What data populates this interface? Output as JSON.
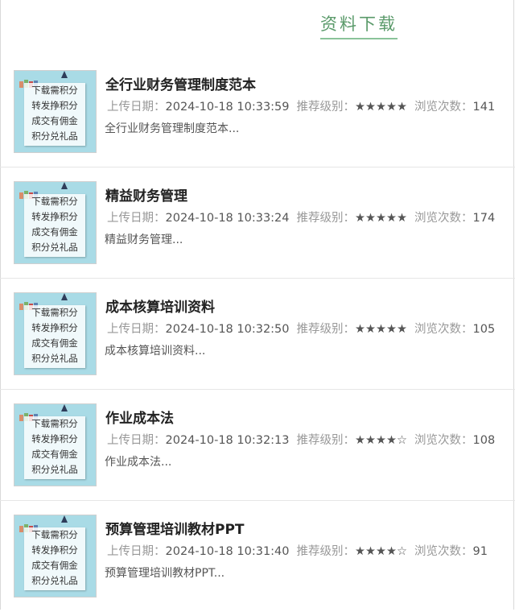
{
  "header": {
    "title": "资料下载"
  },
  "thumbnail": {
    "lines": [
      "下载需积分",
      "转发挣积分",
      "成交有佣金",
      "积分兑礼品"
    ]
  },
  "labels": {
    "date": "上传日期：",
    "rating": "推荐级别：",
    "views": "浏览次数："
  },
  "items": [
    {
      "title": "全行业财务管理制度范本",
      "date": "2024-10-18 10:33:59",
      "stars": "★★★★★",
      "rating": 5,
      "views": "141",
      "desc": "全行业财务管理制度范本..."
    },
    {
      "title": "精益财务管理",
      "date": "2024-10-18 10:33:24",
      "stars": "★★★★★",
      "rating": 5,
      "views": "174",
      "desc": "精益财务管理..."
    },
    {
      "title": "成本核算培训资料",
      "date": "2024-10-18 10:32:50",
      "stars": "★★★★★",
      "rating": 5,
      "views": "105",
      "desc": "成本核算培训资料..."
    },
    {
      "title": "作业成本法",
      "date": "2024-10-18 10:32:13",
      "stars": "★★★★☆",
      "rating": 4,
      "views": "108",
      "desc": "作业成本法..."
    },
    {
      "title": "预算管理培训教材PPT",
      "date": "2024-10-18 10:31:40",
      "stars": "★★★★☆",
      "rating": 4,
      "views": "91",
      "desc": "预算管理培训教材PPT..."
    }
  ]
}
